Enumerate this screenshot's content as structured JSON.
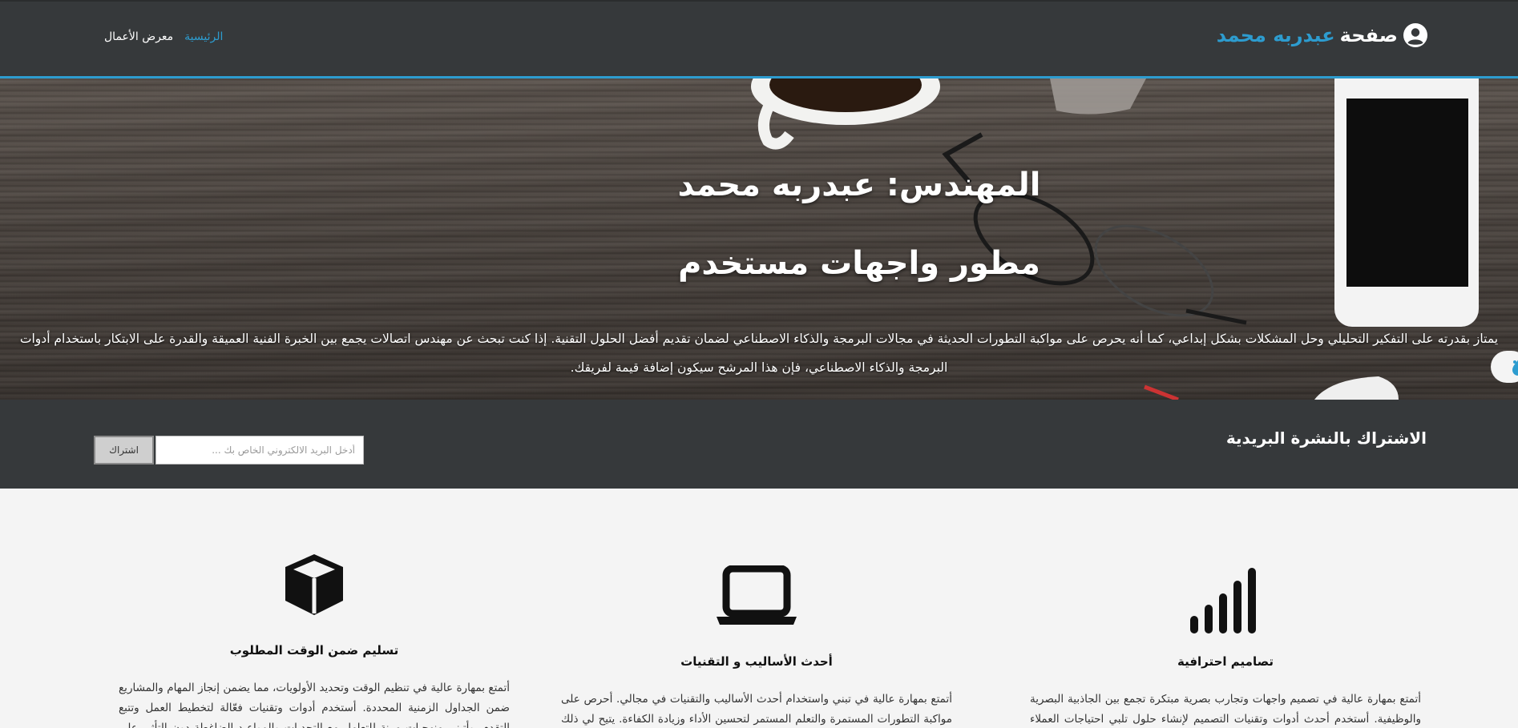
{
  "header": {
    "brand_word": "صفحة",
    "brand_name": "عبدربه محمد",
    "nav": [
      {
        "label": "الرئيسية",
        "active": true
      },
      {
        "label": "معرض الأعمال",
        "active": false
      }
    ],
    "accent_color": "#2d9ccf"
  },
  "hero": {
    "title_line1": "المهندس: عبدربه محمد",
    "title_line2": "مطور واجهات مستخدم",
    "description": "يمتاز بقدرته على التفكير التحليلي وحل المشكلات بشكل إبداعي، كما أنه يحرص على مواكبة التطورات الحديثة في مجالات البرمجة والذكاء الاصطناعي لضمان تقديم أفضل الحلول التقنية. إذا كنت تبحث عن مهندس اتصالات يجمع بين الخبرة الفنية العميقة والقدرة على الابتكار باستخدام أدوات البرمجة والذكاء الاصطناعي، فإن هذا المرشح سيكون إضافة قيمة لفريقك."
  },
  "newsletter": {
    "title": "الاشتراك بالنشرة البريدية",
    "input_placeholder": "أدخل البريد الالكتروني الخاص بك ...",
    "button_label": "اشتراك"
  },
  "features": [
    {
      "icon": "signal-bars-icon",
      "title": "تصاميم احترافية",
      "description": "أتمتع بمهارة عالية في تصميم واجهات وتجارب بصرية مبتكرة تجمع بين الجاذبية البصرية والوظيفية. أستخدم أحدث أدوات وتقنيات التصميم لإنشاء حلول تلبي احتياجات العملاء بدقة وتحقق أهداف العلامة التجارية. أتميز"
    },
    {
      "icon": "laptop-icon",
      "title": "أحدث الأساليب و التقنيات",
      "description": "أتمتع بمهارة عالية في تبني واستخدام أحدث الأساليب والتقنيات في مجالي. أحرص على مواكبة التطورات المستمرة والتعلم المستمر لتحسين الأداء وزيادة الكفاءة. يتيح لي ذلك تقديم حلول مبتكرة وعصرية تلبي متطلبات"
    },
    {
      "icon": "cube-icon",
      "title": "تسليم ضمن الوقت المطلوب",
      "description": "أتمتع بمهارة عالية في تنظيم الوقت وتحديد الأولويات، مما يضمن إنجاز المهام والمشاريع ضمن الجداول الزمنية المحددة. أستخدم أدوات وتقنيات فعّالة لتخطيط العمل وتتبع التقدم، وأتبنى منهجيات مرنة للتعامل مع التحديات والمواعيد الضاغطة دون التأثير على جودة الأداء. هذا الالتزام بالمواعيد يسهم في تحقيق أهداف الفريق والشركة"
    }
  ]
}
